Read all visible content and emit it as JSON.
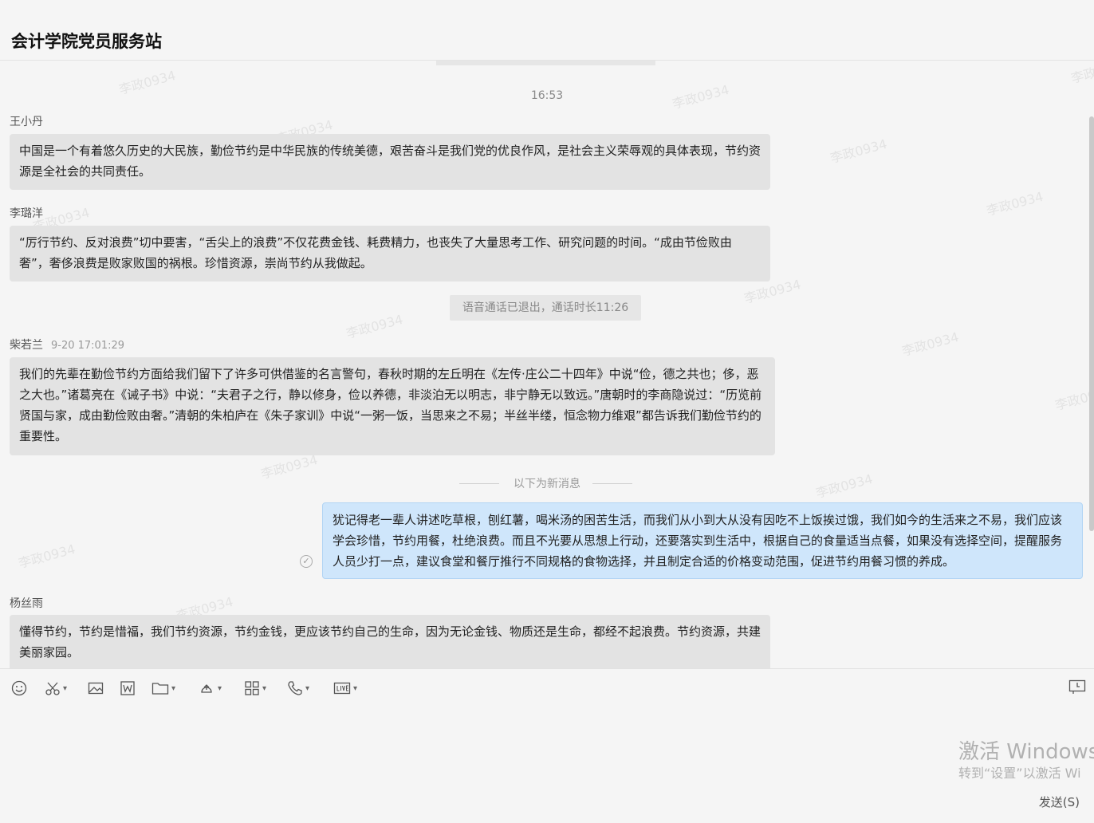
{
  "window": {
    "title": "会计学院党员服务站"
  },
  "chat": {
    "time_label": "16:53",
    "messages": [
      {
        "sender": "王小丹",
        "text": "中国是一个有着悠久历史的大民族，勤俭节约是中华民族的传统美德，艰苦奋斗是我们党的优良作风，是社会主义荣辱观的具体表现，节约资源是全社会的共同责任。"
      },
      {
        "sender": "李璐洋",
        "text": "“厉行节约、反对浪费”切中要害，“舌尖上的浪费”不仅花费金钱、耗费精力，也丧失了大量思考工作、研究问题的时间。“成由节俭败由奢”，奢侈浪费是败家败国的祸根。珍惜资源，崇尚节约从我做起。"
      },
      {
        "sender": "柴若兰",
        "timestamp": "9-20 17:01:29",
        "text": "我们的先辈在勤俭节约方面给我们留下了许多可供借鉴的名言警句，春秋时期的左丘明在《左传·庄公二十四年》中说“俭，德之共也；侈，恶之大也。”诸葛亮在《诫子书》中说：“夫君子之行，静以修身，俭以养德，非淡泊无以明志，非宁静无以致远。”唐朝时的李商隐说过：“历览前贤国与家，成由勤俭败由奢。”清朝的朱柏庐在《朱子家训》中说“一粥一饭，当思来之不易；半丝半缕，恒念物力维艰”都告诉我们勤俭节约的重要性。"
      },
      {
        "sender": "",
        "mine": true,
        "text": "犹记得老一辈人讲述吃草根，刨红薯，喝米汤的困苦生活，而我们从小到大从没有因吃不上饭挨过饿，我们如今的生活来之不易，我们应该学会珍惜，节约用餐，杜绝浪费。而且不光要从思想上行动，还要落实到生活中，根据自己的食量适当点餐，如果没有选择空间，提醒服务人员少打一点，建议食堂和餐厅推行不同规格的食物选择，并且制定合适的价格变动范围，促进节约用餐习惯的养成。"
      },
      {
        "sender": "杨丝雨",
        "text": "懂得节约，节约是惜福，我们节约资源，节约金钱，更应该节约自己的生命，因为无论金钱、物质还是生命，都经不起浪费。节约资源，共建美丽家园。"
      }
    ],
    "system_notice": "语音通话已退出，通话时长11:26",
    "new_divider": "以下为新消息",
    "watermark": "李政0934"
  },
  "toolbar": {
    "icons": [
      "emoji-icon",
      "scissors-icon",
      "image-icon",
      "word-doc-icon",
      "folder-icon",
      "screen-share-icon",
      "apps-icon",
      "phone-icon",
      "live-icon"
    ]
  },
  "os_watermark": {
    "line1": "激活 Windows",
    "line2": "转到“设置”以激活 Wi"
  },
  "send_label": "发送(S)"
}
